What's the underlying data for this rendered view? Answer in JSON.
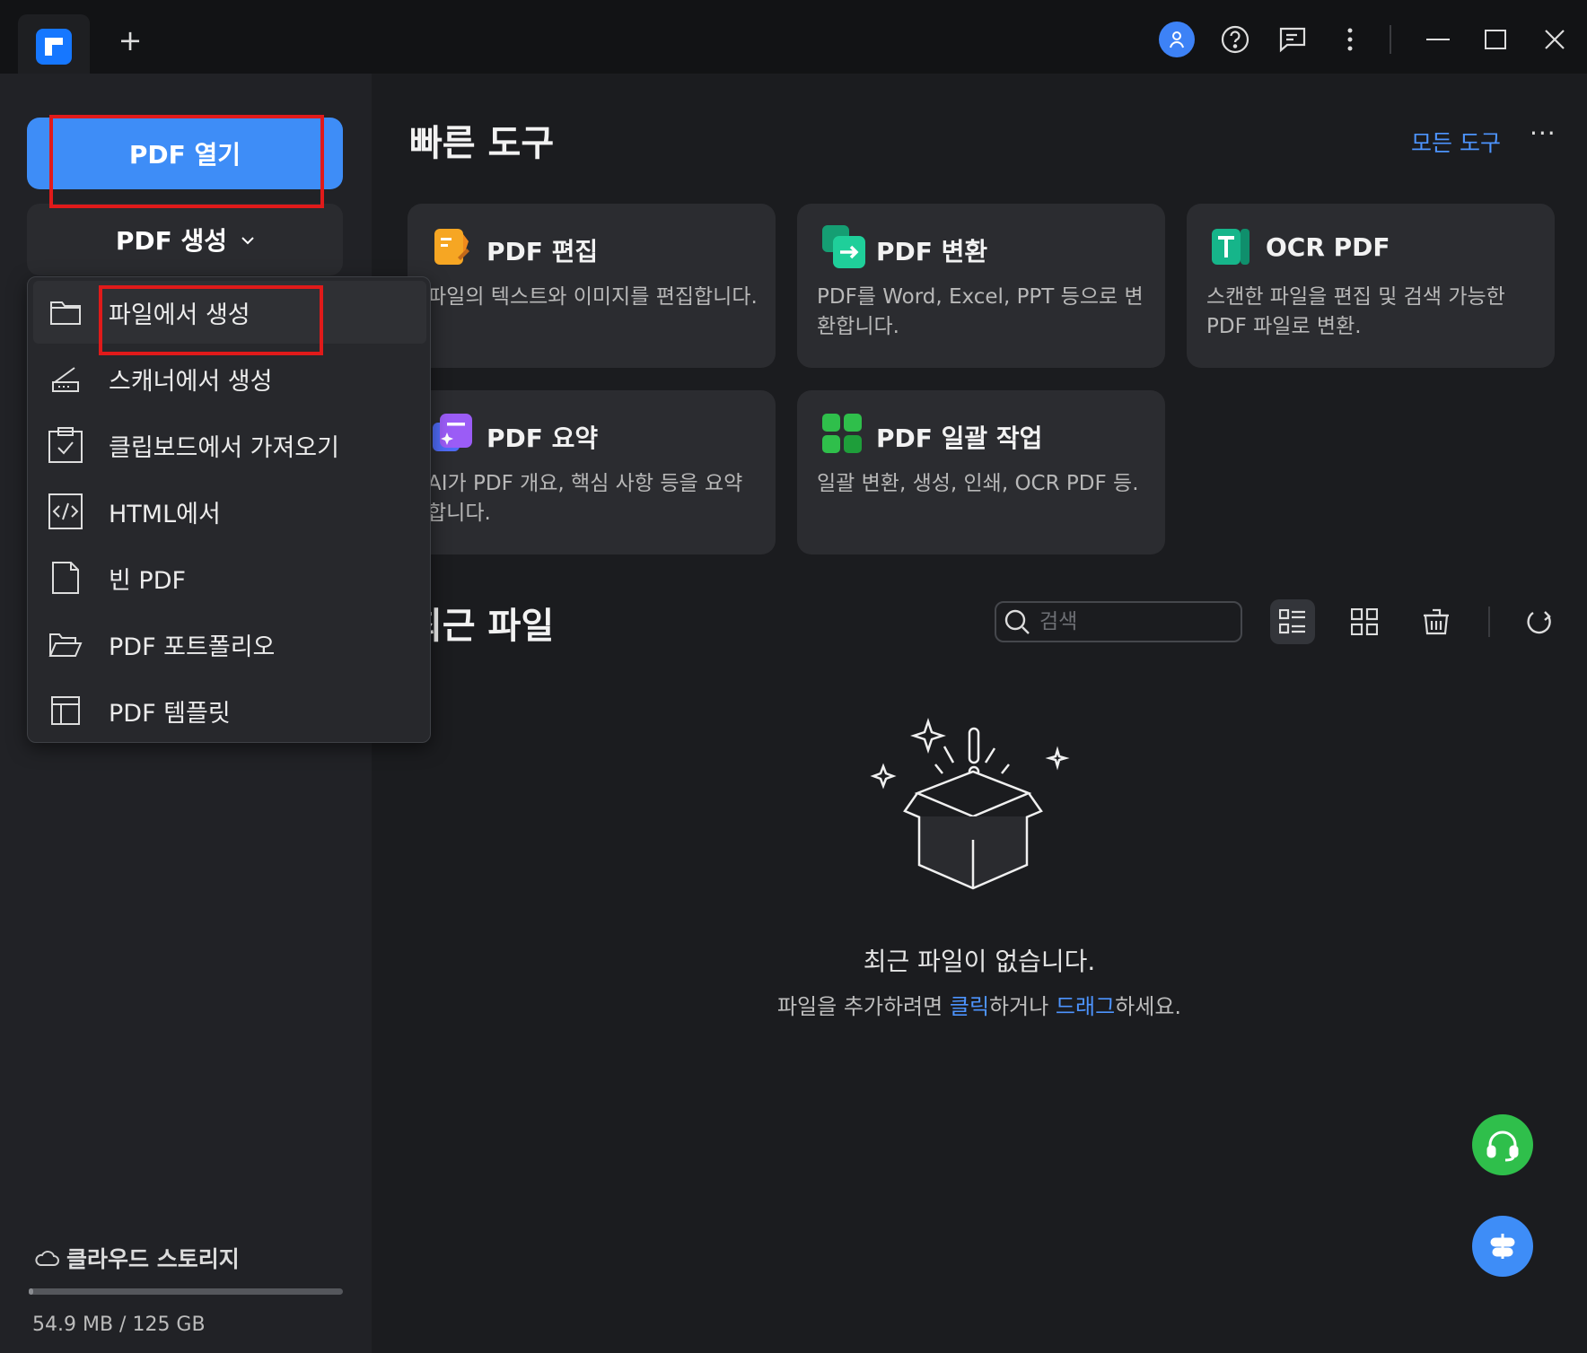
{
  "titlebar": {
    "icons": [
      "app-logo-icon",
      "plus-icon",
      "user-icon",
      "help-icon",
      "feedback-icon",
      "more-vertical-icon",
      "minimize-icon",
      "maximize-icon",
      "close-icon"
    ]
  },
  "sidebar": {
    "open_label": "PDF 열기",
    "create_label": "PDF 생성",
    "storage_label": "클라우드 스토리지",
    "storage_usage": "54.9 MB / 125 GB",
    "storage_fraction": 0.0004
  },
  "dropdown": {
    "items": [
      {
        "label": "파일에서 생성",
        "icon": "folder-icon"
      },
      {
        "label": "스캐너에서 생성",
        "icon": "scanner-icon"
      },
      {
        "label": "클립보드에서 가져오기",
        "icon": "clipboard-icon"
      },
      {
        "label": "HTML에서",
        "icon": "html-code-icon"
      },
      {
        "label": "빈 PDF",
        "icon": "blank-page-icon"
      },
      {
        "label": "PDF 포트폴리오",
        "icon": "open-folder-icon"
      },
      {
        "label": "PDF 템플릿",
        "icon": "template-icon"
      }
    ]
  },
  "quick_tools": {
    "heading": "빠른 도구",
    "all_tools": "모든 도구",
    "more": "···",
    "cards": [
      {
        "title": "PDF 편집",
        "desc": "파일의 텍스트와 이미지를 편집합니다.",
        "icon": "edit-pdf-icon",
        "color": "#f6a623"
      },
      {
        "title": "PDF 변환",
        "desc": "PDF를 Word, Excel, PPT 등으로 변환합니다.",
        "icon": "convert-pdf-icon",
        "color": "#1fbf8f"
      },
      {
        "title": "OCR PDF",
        "desc": "스캔한 파일을 편집 및 검색 가능한 PDF 파일로 변환.",
        "icon": "ocr-icon",
        "color": "#16b58a"
      },
      {
        "title": "PDF 요약",
        "desc": "AI가 PDF 개요, 핵심 사항 등을 요약합니다.",
        "icon": "summary-icon",
        "color": "#7c5cf6"
      },
      {
        "title": "PDF 일괄 작업",
        "desc": "일괄 변환, 생성, 인쇄, OCR PDF 등.",
        "icon": "batch-icon",
        "color": "#2fbf4b"
      }
    ]
  },
  "recent": {
    "heading": "최근 파일",
    "search_placeholder": "검색",
    "empty_title": "최근 파일이 없습니다.",
    "empty_sub_prefix": "파일을 추가하려면 ",
    "empty_click": "클릭",
    "empty_mid": "하거나 ",
    "empty_drag": "드래그",
    "empty_suffix": "하세요."
  }
}
